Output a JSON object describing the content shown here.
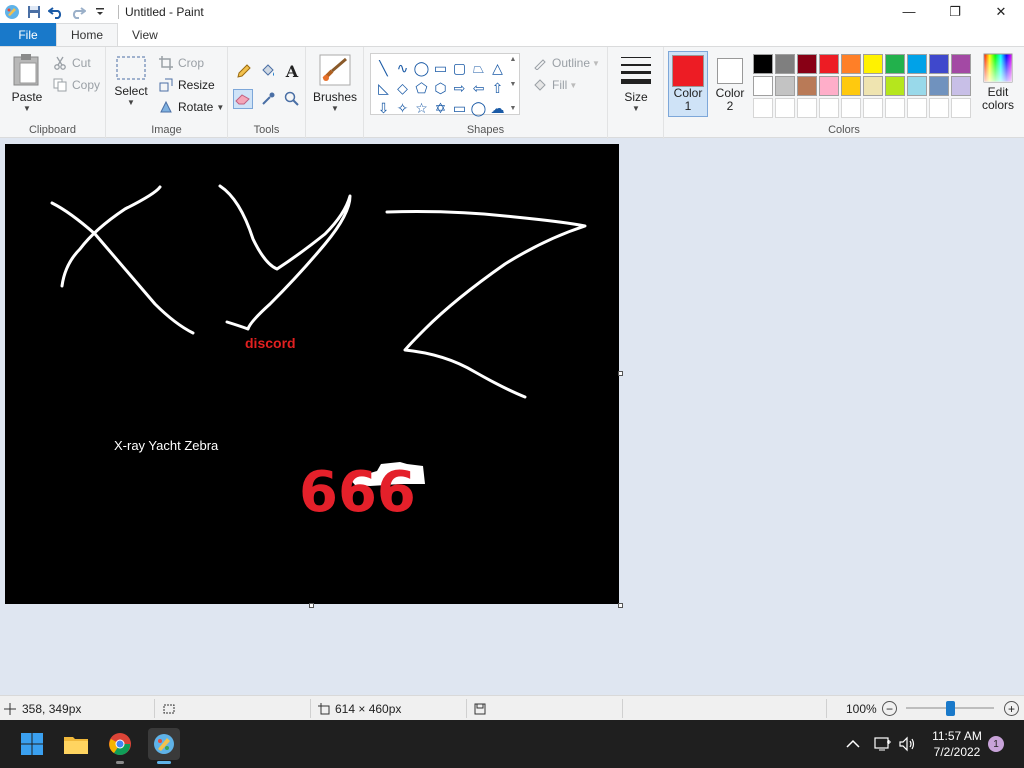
{
  "window": {
    "title": "Untitled - Paint",
    "minimize": "—",
    "maximize": "❐",
    "close": "✕"
  },
  "tabs": {
    "file": "File",
    "home": "Home",
    "view": "View"
  },
  "clipboard": {
    "paste": "Paste",
    "cut": "Cut",
    "copy": "Copy",
    "label": "Clipboard"
  },
  "image": {
    "select": "Select",
    "crop": "Crop",
    "resize": "Resize",
    "rotate": "Rotate",
    "label": "Image"
  },
  "tools": {
    "label": "Tools",
    "text_glyph": "A"
  },
  "brushes": {
    "label": "Brushes"
  },
  "shapes": {
    "outline": "Outline",
    "fill": "Fill",
    "label": "Shapes"
  },
  "size": {
    "label": "Size"
  },
  "colors": {
    "color1_label": "Color\n1",
    "color1_line1": "Color",
    "color1_line2": "1",
    "color2_line1": "Color",
    "color2_line2": "2",
    "color1_value": "#ed1c24",
    "color2_value": "#ffffff",
    "edit_line1": "Edit",
    "edit_line2": "colors",
    "label": "Colors",
    "palette_row1": [
      "#000000",
      "#7f7f7f",
      "#880015",
      "#ed1c24",
      "#ff7f27",
      "#fff200",
      "#22b14c",
      "#00a2e8",
      "#3f48cc",
      "#a349a4"
    ],
    "palette_row2": [
      "#ffffff",
      "#c3c3c3",
      "#b97a57",
      "#ffaec9",
      "#ffc90e",
      "#efe4b0",
      "#b5e61d",
      "#99d9ea",
      "#7092be",
      "#c8bfe7"
    ]
  },
  "canvas": {
    "text_discord": "discord",
    "text_xyz": "X-ray Yacht Zebra",
    "text_666": "666"
  },
  "status": {
    "cursor_pos": "358, 349px",
    "canvas_size": "614 × 460px",
    "zoom": "100%",
    "zoom_level_fraction": 0.5
  },
  "taskbar": {
    "time": "11:57 AM",
    "date": "7/2/2022",
    "notification_count": "1"
  }
}
